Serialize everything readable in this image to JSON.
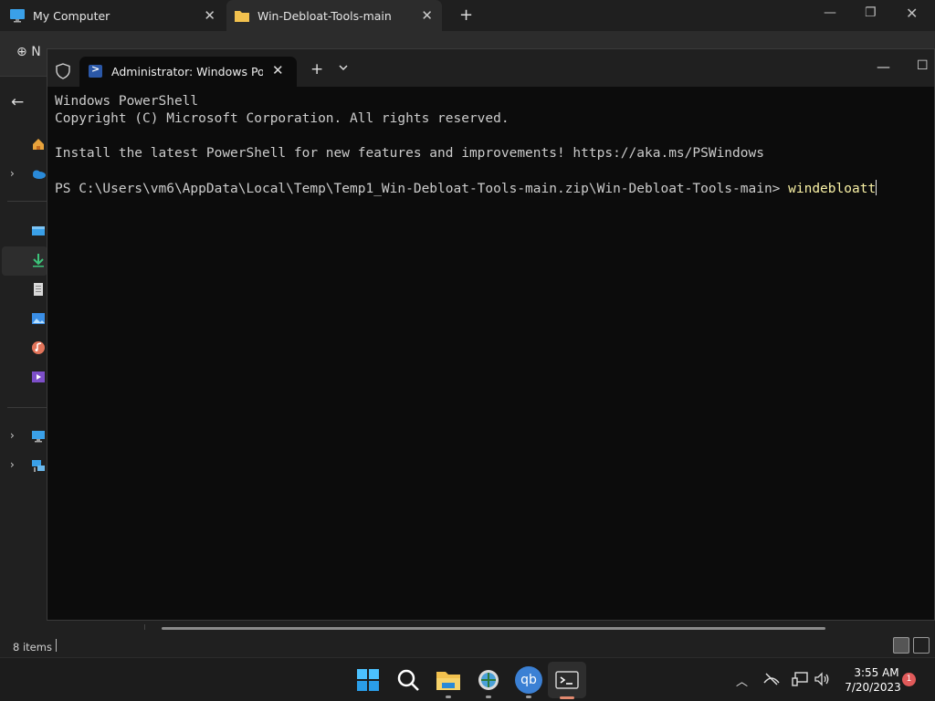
{
  "explorer": {
    "tabs": [
      {
        "label": "My Computer",
        "icon": "monitor-icon"
      },
      {
        "label": "Win-Debloat-Tools-main",
        "icon": "folder-icon"
      }
    ],
    "new_button_label": "N",
    "status_count": "8 items"
  },
  "terminal": {
    "tab_title": "Administrator: Windows PowerShell",
    "lines": [
      "Windows PowerShell",
      "Copyright (C) Microsoft Corporation. All rights reserved.",
      "",
      "Install the latest PowerShell for new features and improvements! https://aka.ms/PSWindows",
      ""
    ],
    "prompt": "PS C:\\Users\\vm6\\AppData\\Local\\Temp\\Temp1_Win-Debloat-Tools-main.zip\\Win-Debloat-Tools-main> ",
    "command": "windebloatt",
    "colors": {
      "background": "#0c0c0c",
      "text": "#cccccc",
      "command": "#f9f1a5"
    }
  },
  "taskbar": {
    "time": "3:55 AM",
    "date": "7/20/2023",
    "notification_count": "1",
    "qb_label": "qb"
  }
}
